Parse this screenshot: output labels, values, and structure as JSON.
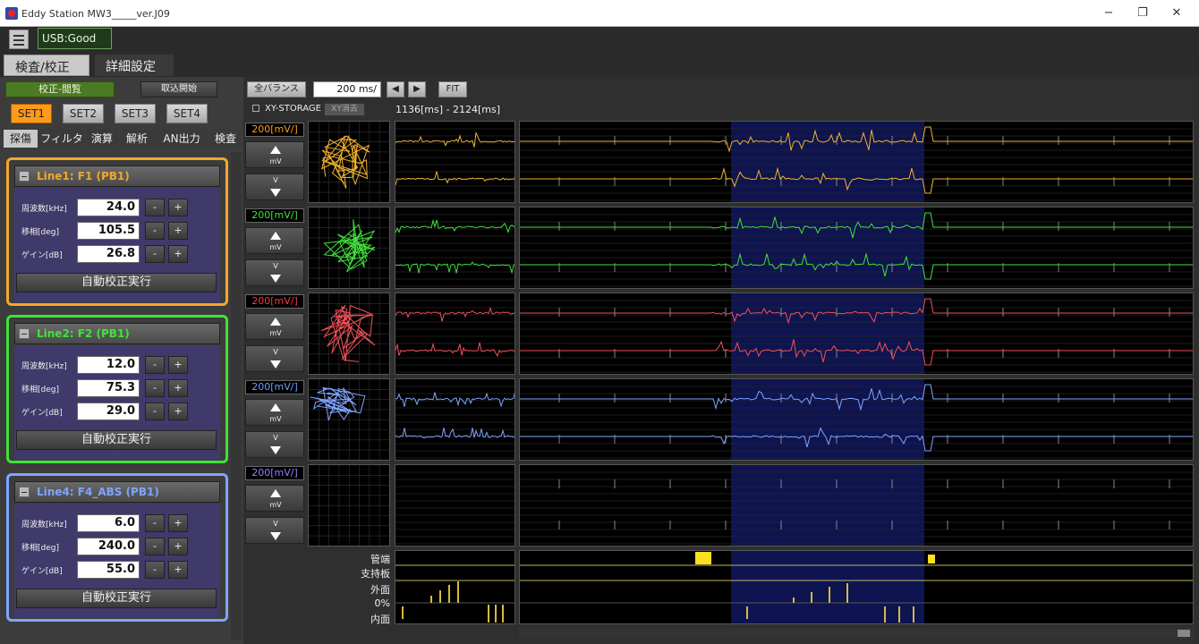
{
  "window": {
    "title": "Eddy Station MW3_____ver.J09",
    "controls": {
      "minimize": "−",
      "restore": "❐",
      "close": "✕"
    }
  },
  "header": {
    "usb_status": "USB:Good"
  },
  "main_tabs": [
    {
      "label": "検査/校正",
      "active": true
    },
    {
      "label": "詳細設定",
      "active": false
    }
  ],
  "left": {
    "kosei_label": "校正-閲覧",
    "torikomi_label": "取込開始",
    "sets": [
      "SET1",
      "SET2",
      "SET3",
      "SET4"
    ],
    "active_set": "SET1",
    "subtabs": [
      "探傷",
      "フィルタ",
      "演算",
      "解析",
      "AN出力",
      "検査"
    ],
    "param_labels": {
      "freq": "周波数[kHz]",
      "phase": "移相[deg]",
      "gain": "ゲイン[dB]"
    },
    "minus": "-",
    "plus": "+",
    "auto_button": "自動校正実行",
    "lines": [
      {
        "title": "Line1: F1 (PB1)",
        "color": "#f2a72e",
        "freq": "24.0",
        "phase": "105.5",
        "gain": "26.8"
      },
      {
        "title": "Line2: F2 (PB1)",
        "color": "#3fe23a",
        "freq": "12.0",
        "phase": "75.3",
        "gain": "29.0"
      },
      {
        "title": "Line4: F4_ABS (PB1)",
        "color": "#7fa4ff",
        "freq": "6.0",
        "phase": "240.0",
        "gain": "55.0"
      }
    ]
  },
  "toolbar": {
    "all_balance": "全バランス",
    "ms_value": "200 ms/",
    "prev_icon": "◀",
    "next_icon": "▶",
    "fit": "FIT",
    "xy_storage": "XY-STORAGE",
    "xy_clear": "XY消去",
    "time_range": "1136[ms] - 2124[ms]"
  },
  "channels": [
    {
      "scale": "200[mV/]",
      "color": "#f2b12f",
      "scale_color": "#ff9b1a"
    },
    {
      "scale": "200[mV/]",
      "color": "#3fe23a",
      "scale_color": "#3fe23a"
    },
    {
      "scale": "200[mV/]",
      "color": "#f0505a",
      "scale_color": "#ff3040"
    },
    {
      "scale": "200[mV/]",
      "color": "#7fa4ff",
      "scale_color": "#6f9cff"
    },
    {
      "scale": "200[mV/]",
      "color": "#9b7cff",
      "scale_color": "#9b7cff"
    }
  ],
  "arrow_labels": {
    "up": "mV",
    "down": "V"
  },
  "strip_labels": [
    "管端",
    "支持板",
    "外面",
    "0%",
    "内面"
  ]
}
